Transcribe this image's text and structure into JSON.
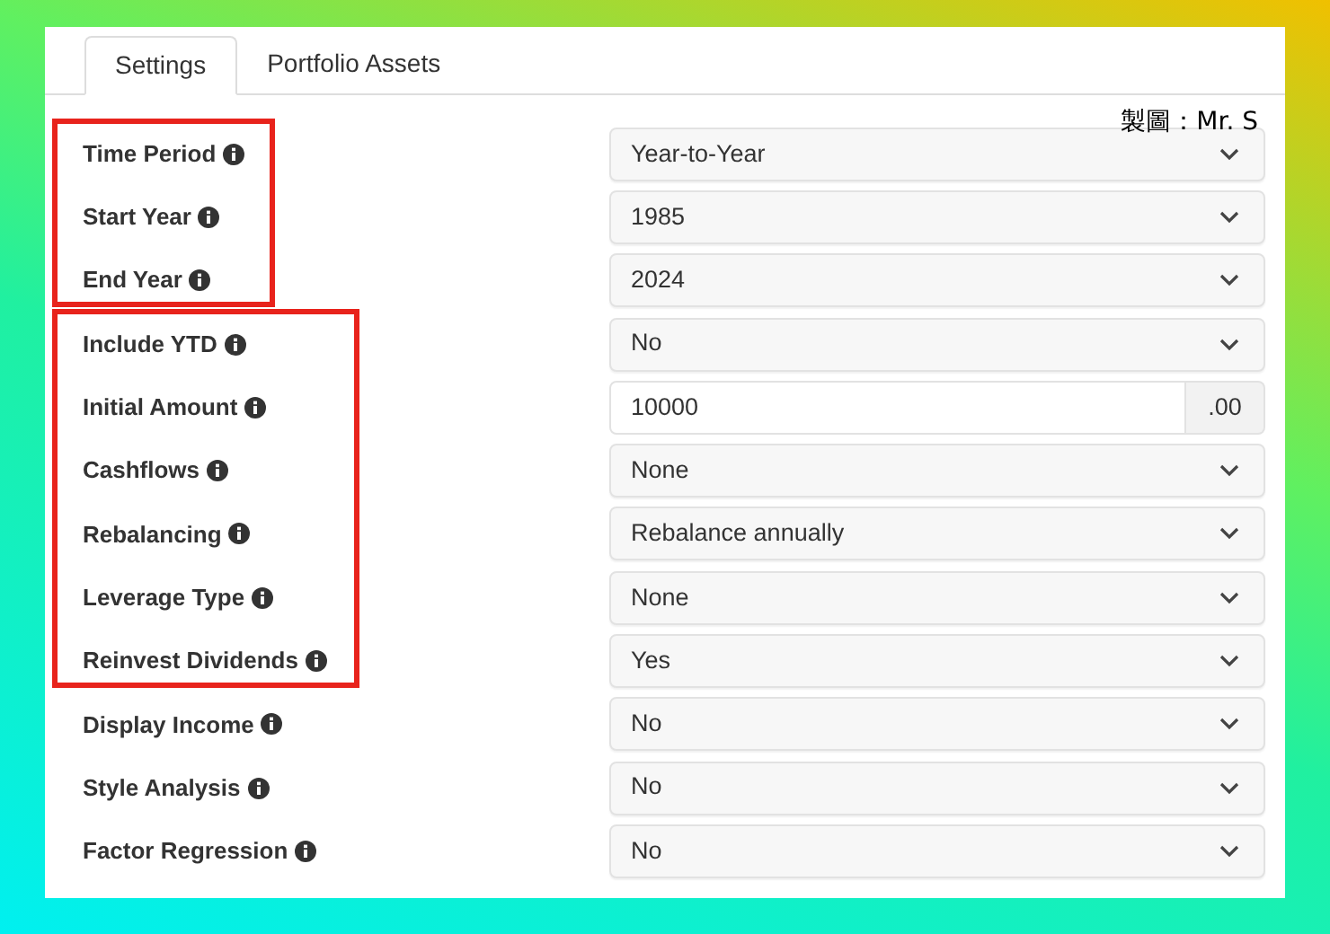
{
  "tabs": [
    {
      "label": "Settings",
      "selected": true
    },
    {
      "label": "Portfolio Assets",
      "selected": false
    }
  ],
  "credit": "製圖：Mr. S",
  "groups": [
    {
      "highlighted": true,
      "rows": [
        {
          "label": "Time Period",
          "kind": "select",
          "value": "Year-to-Year"
        },
        {
          "label": "Start Year",
          "kind": "select",
          "value": "1985"
        },
        {
          "label": "End Year",
          "kind": "select",
          "value": "2024"
        }
      ]
    },
    {
      "highlighted": true,
      "rows": [
        {
          "label": "Include YTD",
          "kind": "select",
          "value": "No"
        },
        {
          "label": "Initial Amount",
          "kind": "input",
          "value": "10000",
          "addon": ".00"
        },
        {
          "label": "Cashflows",
          "kind": "select",
          "value": "None"
        },
        {
          "label": "Rebalancing",
          "kind": "select",
          "value": "Rebalance annually"
        },
        {
          "label": "Leverage Type",
          "kind": "select",
          "value": "None"
        },
        {
          "label": "Reinvest Dividends",
          "kind": "select",
          "value": "Yes"
        }
      ]
    },
    {
      "highlighted": false,
      "rows": [
        {
          "label": "Display Income",
          "kind": "select",
          "value": "No"
        },
        {
          "label": "Style Analysis",
          "kind": "select",
          "value": "No"
        },
        {
          "label": "Factor Regression",
          "kind": "select",
          "value": "No"
        }
      ]
    }
  ]
}
